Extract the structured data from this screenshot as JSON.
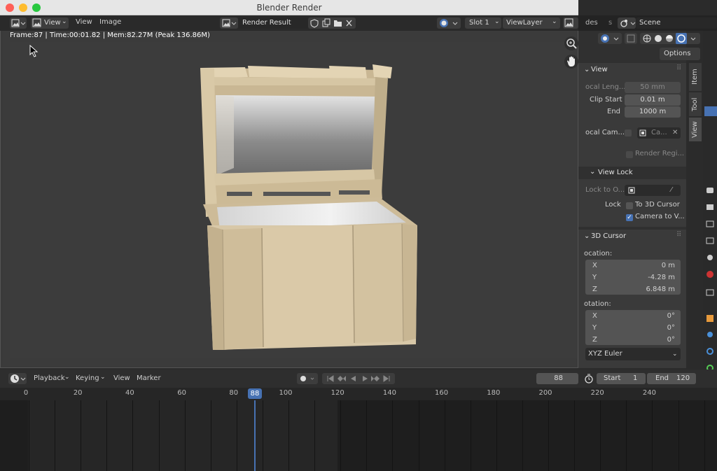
{
  "window": {
    "title": "Blender Render"
  },
  "image_header": {
    "menus": [
      "View",
      "View",
      "Image"
    ],
    "image_name": "Render Result",
    "slot": "Slot 1",
    "view_layer": "ViewLayer"
  },
  "render_info": "Frame:87 | Time:00:01.82 | Mem:82.27M (Peak 136.86M)",
  "top_right": {
    "partial_label": "des",
    "partial_label2": "s",
    "scene": "Scene"
  },
  "sidebar": {
    "options_label": "Options",
    "tabs": [
      "Item",
      "Tool",
      "View"
    ],
    "view_section": {
      "title": "View",
      "focal_length_label": "ocal Leng...",
      "focal_length_value": "50 mm",
      "clip_start_label": "Clip Start",
      "clip_start_value": "0.01 m",
      "clip_end_label": "End",
      "clip_end_value": "1000 m",
      "local_camera_label": "ocal Cam...",
      "local_camera_value": "Ca...",
      "render_region_label": "Render Regi..."
    },
    "view_lock": {
      "title": "View Lock",
      "lock_to_object_label": "Lock to O...",
      "lock_label": "Lock",
      "to_3d_cursor_label": "To 3D Cursor",
      "camera_to_view_label": "Camera to V..."
    },
    "cursor": {
      "title": "3D Cursor",
      "location_label": "ocation:",
      "location": [
        {
          "axis": "X",
          "value": "0 m"
        },
        {
          "axis": "Y",
          "value": "-4.28 m"
        },
        {
          "axis": "Z",
          "value": "6.848 m"
        }
      ],
      "rotation_label": "otation:",
      "rotation": [
        {
          "axis": "X",
          "value": "0°"
        },
        {
          "axis": "Y",
          "value": "0°"
        },
        {
          "axis": "Z",
          "value": "0°"
        }
      ],
      "rotation_mode": "XYZ Euler"
    }
  },
  "timeline": {
    "menus": [
      "Playback",
      "Keying",
      "View",
      "Marker"
    ],
    "current_frame": "88",
    "start_label": "Start",
    "start_value": "1",
    "end_label": "End",
    "end_value": "120",
    "ruler": [
      "0",
      "20",
      "40",
      "60",
      "80",
      "88",
      "100",
      "120",
      "140",
      "160",
      "180",
      "200",
      "220",
      "240"
    ]
  },
  "colors": {
    "accent": "#4772b3",
    "wood": "#d8c8a8",
    "playhead": "#4772b3"
  }
}
